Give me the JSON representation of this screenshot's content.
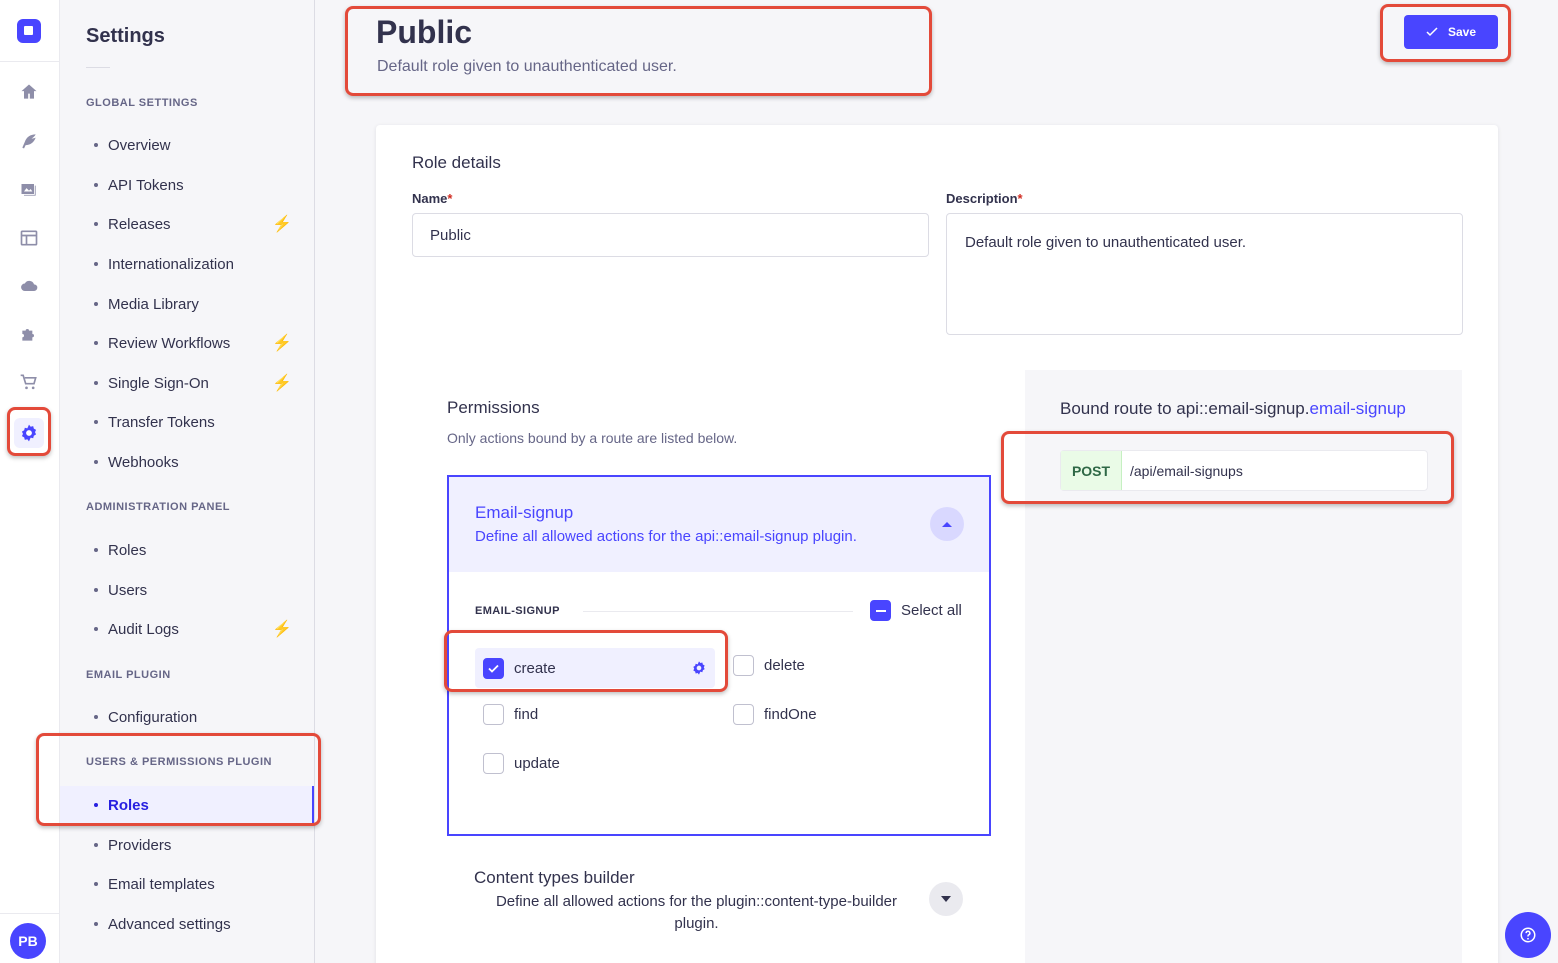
{
  "rail": {
    "icons": [
      "logo-icon",
      "home-icon",
      "feather-icon",
      "image-icon",
      "layout-icon",
      "cloud-icon",
      "puzzle-icon",
      "cart-icon",
      "gear-icon"
    ],
    "avatar": "PB"
  },
  "subnav": {
    "title": "Settings",
    "sections": [
      {
        "label": "GLOBAL SETTINGS"
      },
      {
        "label": "ADMINISTRATION PANEL"
      },
      {
        "label": "EMAIL PLUGIN"
      },
      {
        "label": "USERS & PERMISSIONS PLUGIN"
      }
    ],
    "items": [
      {
        "label": "Overview"
      },
      {
        "label": "API Tokens"
      },
      {
        "label": "Releases"
      },
      {
        "label": "Internationalization"
      },
      {
        "label": "Media Library"
      },
      {
        "label": "Review Workflows"
      },
      {
        "label": "Single Sign-On"
      },
      {
        "label": "Transfer Tokens"
      },
      {
        "label": "Webhooks"
      },
      {
        "label": "Roles"
      },
      {
        "label": "Users"
      },
      {
        "label": "Audit Logs"
      },
      {
        "label": "Configuration"
      },
      {
        "label": "Roles"
      },
      {
        "label": "Providers"
      },
      {
        "label": "Email templates"
      },
      {
        "label": "Advanced settings"
      }
    ]
  },
  "header": {
    "title": "Public",
    "subtitle": "Default role given to unauthenticated user.",
    "save_label": "Save"
  },
  "role_details": {
    "heading": "Role details",
    "name_label": "Name",
    "name_value": "Public",
    "description_label": "Description",
    "description_value": "Default role given to unauthenticated user.",
    "required_mark": "*"
  },
  "permissions": {
    "heading": "Permissions",
    "hint": "Only actions bound by a route are listed below.",
    "accordion": {
      "title": "Email-signup",
      "description": "Define all allowed actions for the api::email-signup plugin.",
      "group_label": "EMAIL-SIGNUP",
      "select_all": "Select all",
      "actions": [
        {
          "label": "create",
          "checked": true
        },
        {
          "label": "delete",
          "checked": false
        },
        {
          "label": "find",
          "checked": false
        },
        {
          "label": "findOne",
          "checked": false
        },
        {
          "label": "update",
          "checked": false
        }
      ]
    },
    "accordion2": {
      "title": "Content types builder",
      "description": "Define all allowed actions for the plugin::content-type-builder plugin."
    }
  },
  "bound_route": {
    "prefix": "Bound route to api::email-signup.",
    "highlight": "email-signup",
    "method": "POST",
    "path": "/api/email-signups"
  },
  "colors": {
    "accent": "#4945ff",
    "annotation": "#e34a3a",
    "bolt": "#f29d41"
  }
}
